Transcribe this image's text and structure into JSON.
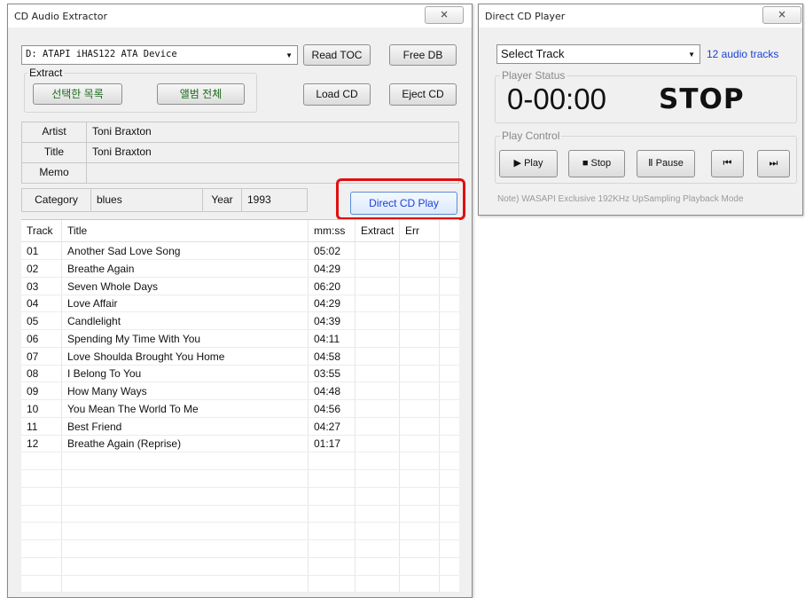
{
  "extractor": {
    "title": "CD Audio Extractor",
    "close_glyph": "🗙",
    "drive": "D: ATAPI iHAS122 ATA Device",
    "read_toc": "Read TOC",
    "free_db": "Free DB",
    "extract_group": "Extract",
    "selected_list": "선택한 목록",
    "whole_album": "앨범 전체",
    "load_cd": "Load CD",
    "eject_cd": "Eject CD",
    "artist_label": "Artist",
    "artist_value": "Toni Braxton",
    "title_label": "Title",
    "title_value": "Toni Braxton",
    "memo_label": "Memo",
    "memo_value": "",
    "category_label": "Category",
    "category_value": "blues",
    "year_label": "Year",
    "year_value": "1993",
    "direct_cd_play": "Direct CD Play",
    "columns": [
      "Track",
      "Title",
      "mm:ss",
      "Extract",
      "Err"
    ],
    "tracks": [
      {
        "track": "01",
        "title": "Another Sad Love Song",
        "time": "05:02"
      },
      {
        "track": "02",
        "title": "Breathe Again",
        "time": "04:29"
      },
      {
        "track": "03",
        "title": "Seven Whole Days",
        "time": "06:20"
      },
      {
        "track": "04",
        "title": "Love Affair",
        "time": "04:29"
      },
      {
        "track": "05",
        "title": "Candlelight",
        "time": "04:39"
      },
      {
        "track": "06",
        "title": "Spending My Time With You",
        "time": "04:11"
      },
      {
        "track": "07",
        "title": "Love Shoulda Brought You Home",
        "time": "04:58"
      },
      {
        "track": "08",
        "title": "I Belong To You",
        "time": "03:55"
      },
      {
        "track": "09",
        "title": "How Many Ways",
        "time": "04:48"
      },
      {
        "track": "10",
        "title": "You Mean The World To Me",
        "time": "04:56"
      },
      {
        "track": "11",
        "title": "Best Friend",
        "time": "04:27"
      },
      {
        "track": "12",
        "title": "Breathe Again (Reprise)",
        "time": "01:17"
      }
    ]
  },
  "player": {
    "title": "Direct CD Player",
    "close_glyph": "🗙",
    "select_track": "Select Track",
    "track_count": "12 audio tracks",
    "status_group": "Player Status",
    "time": "0-00:00",
    "state": "STOP",
    "control_group": "Play Control",
    "play": "Play",
    "stop": "Stop",
    "pause": "Pause",
    "note": "Note) WASAPI Exclusive 192KHz UpSampling Playback Mode",
    "accent_color": "#1a3fd8"
  }
}
